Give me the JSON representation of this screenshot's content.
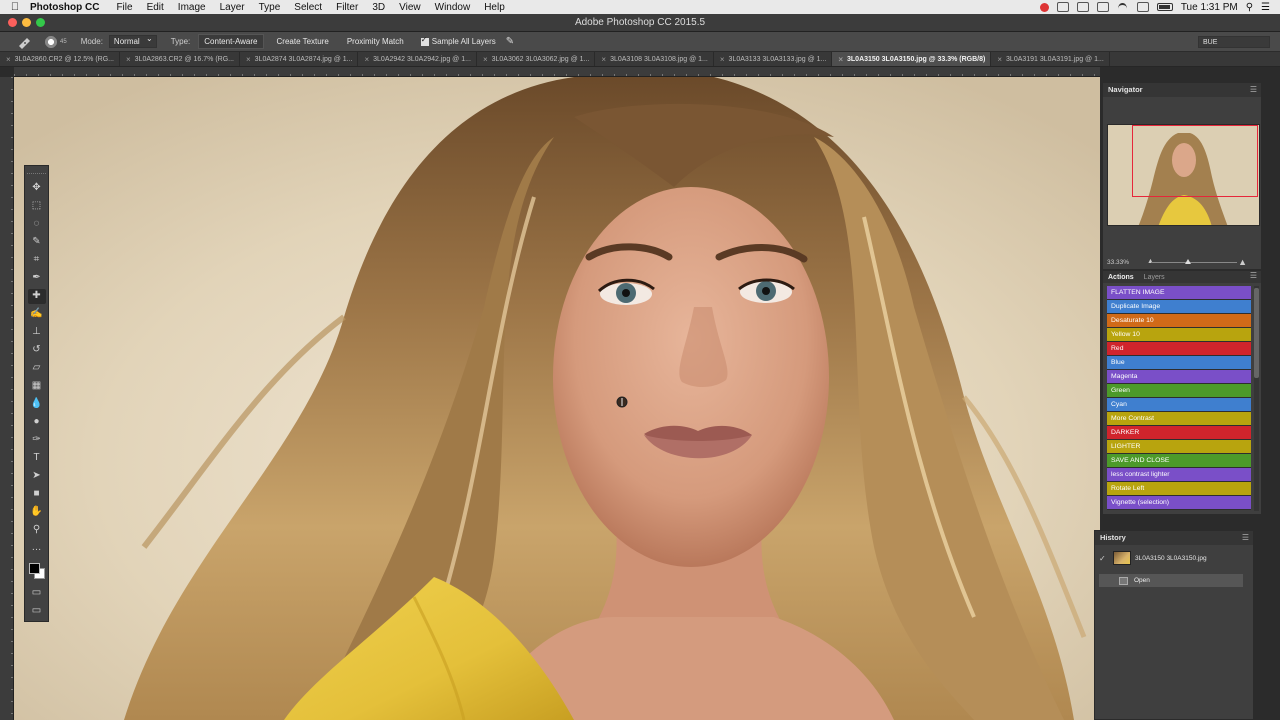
{
  "menubar": {
    "app_name": "Photoshop CC",
    "items": [
      "File",
      "Edit",
      "Image",
      "Layer",
      "Type",
      "Select",
      "Filter",
      "3D",
      "View",
      "Window",
      "Help"
    ],
    "clock": "Tue 1:31 PM"
  },
  "window": {
    "title": "Adobe Photoshop CC 2015.5"
  },
  "options": {
    "brush_size": "45",
    "mode_label": "Mode:",
    "mode_value": "Normal",
    "type_label": "Type:",
    "type_options": [
      "Content-Aware",
      "Create Texture",
      "Proximity Match"
    ],
    "sample_all_label": "Sample All Layers",
    "workspace": "BUE"
  },
  "tabs": [
    {
      "label": "3L0A2860.CR2 @ 12.5% (RG...",
      "active": false
    },
    {
      "label": "3L0A2863.CR2 @ 16.7% (RG...",
      "active": false
    },
    {
      "label": "3L0A2874 3L0A2874.jpg @ 1...",
      "active": false
    },
    {
      "label": "3L0A2942 3L0A2942.jpg @ 1...",
      "active": false
    },
    {
      "label": "3L0A3062 3L0A3062.jpg @ 1...",
      "active": false
    },
    {
      "label": "3L0A3108 3L0A3108.jpg @ 1...",
      "active": false
    },
    {
      "label": "3L0A3133 3L0A3133.jpg @ 1...",
      "active": false
    },
    {
      "label": "3L0A3150 3L0A3150.jpg @ 33.3% (RGB/8)",
      "active": true
    },
    {
      "label": "3L0A3191 3L0A3191.jpg @ 1...",
      "active": false
    }
  ],
  "tools": [
    {
      "name": "move-tool",
      "glyph": "✥"
    },
    {
      "name": "marquee-tool",
      "glyph": "⬚"
    },
    {
      "name": "lasso-tool",
      "glyph": "◌"
    },
    {
      "name": "quick-select-tool",
      "glyph": "✎"
    },
    {
      "name": "crop-tool",
      "glyph": "⌗"
    },
    {
      "name": "eyedropper-tool",
      "glyph": "✒"
    },
    {
      "name": "spot-healing-tool",
      "glyph": "✚"
    },
    {
      "name": "brush-tool",
      "glyph": "✍"
    },
    {
      "name": "clone-stamp-tool",
      "glyph": "⊥"
    },
    {
      "name": "history-brush-tool",
      "glyph": "↺"
    },
    {
      "name": "eraser-tool",
      "glyph": "▱"
    },
    {
      "name": "gradient-tool",
      "glyph": "▦"
    },
    {
      "name": "blur-tool",
      "glyph": "💧"
    },
    {
      "name": "dodge-tool",
      "glyph": "●"
    },
    {
      "name": "pen-tool",
      "glyph": "✑"
    },
    {
      "name": "type-tool",
      "glyph": "T"
    },
    {
      "name": "path-select-tool",
      "glyph": "➤"
    },
    {
      "name": "shape-tool",
      "glyph": "■"
    },
    {
      "name": "hand-tool",
      "glyph": "✋"
    },
    {
      "name": "zoom-tool",
      "glyph": "⚲"
    },
    {
      "name": "more-tools",
      "glyph": "…"
    }
  ],
  "navigator": {
    "title": "Navigator",
    "zoom": "33.33%"
  },
  "actions": {
    "tab_active": "Actions",
    "tab_other": "Layers",
    "items": [
      {
        "label": "FLATTEN IMAGE",
        "color": "#7a4fc8"
      },
      {
        "label": "Duplicate Image",
        "color": "#3f7fcf"
      },
      {
        "label": "Desaturate 10",
        "color": "#d06a18"
      },
      {
        "label": "Yellow 10",
        "color": "#b8a40e"
      },
      {
        "label": "Red",
        "color": "#d0242c"
      },
      {
        "label": "Blue",
        "color": "#3f7fcf"
      },
      {
        "label": "Magenta",
        "color": "#7a4fc8"
      },
      {
        "label": "Green",
        "color": "#4c9a2a"
      },
      {
        "label": "Cyan",
        "color": "#3f7fcf"
      },
      {
        "label": "More Contrast",
        "color": "#b8a40e"
      },
      {
        "label": "DARKER",
        "color": "#d0242c"
      },
      {
        "label": "LIGHTER",
        "color": "#b8a40e"
      },
      {
        "label": "SAVE AND CLOSE",
        "color": "#4c9a2a"
      },
      {
        "label": "less contrast lighter",
        "color": "#7a4fc8"
      },
      {
        "label": "Rotate Left",
        "color": "#b8a40e"
      },
      {
        "label": "Vignette (selection)",
        "color": "#7a4fc8"
      }
    ]
  },
  "history": {
    "title": "History",
    "snapshot": "3L0A3150 3L0A3150.jpg",
    "step": "Open"
  }
}
